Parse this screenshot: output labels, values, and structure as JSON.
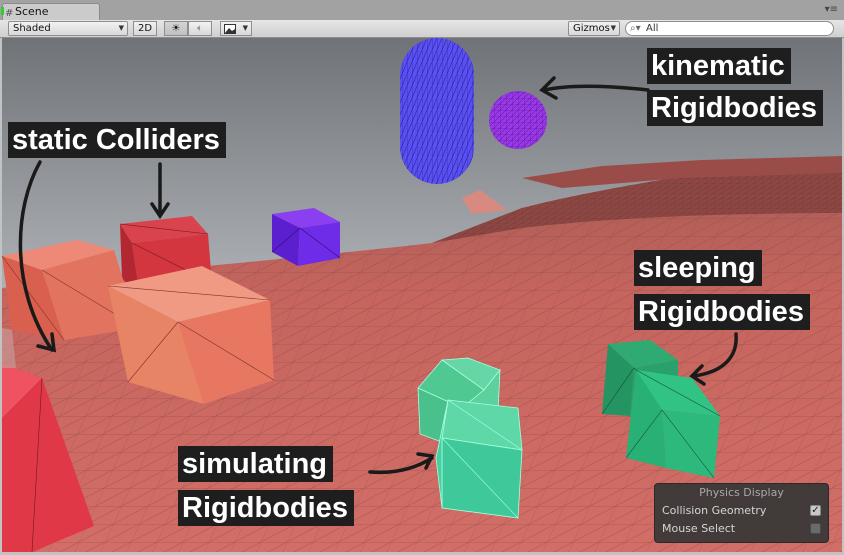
{
  "tab": {
    "label": "Scene"
  },
  "toolbar": {
    "draw_mode": "Shaded",
    "mode_2d": "2D",
    "gizmos": "Gizmos",
    "search_value": "All"
  },
  "labels": {
    "kinematic_1": "kinematic",
    "kinematic_2": "Rigidbodies",
    "static_1": "static Colliders",
    "sleeping_1": "sleeping",
    "sleeping_2": "Rigidbodies",
    "simulating_1": "simulating",
    "simulating_2": "Rigidbodies"
  },
  "physics_display": {
    "title": "Physics Display",
    "rows": [
      {
        "label": "Collision Geometry",
        "checked": true
      },
      {
        "label": "Mouse Select",
        "checked": false
      }
    ]
  },
  "colors": {
    "kinematic": "#5a4ff0",
    "static": "#e8705a",
    "sleeping": "#2fbf7e",
    "simulating": "#58d6a0",
    "terrain": "#c8665f"
  },
  "icons": [
    "scene-grid-icon",
    "sun-icon",
    "speaker-icon",
    "image-icon",
    "search-icon"
  ]
}
